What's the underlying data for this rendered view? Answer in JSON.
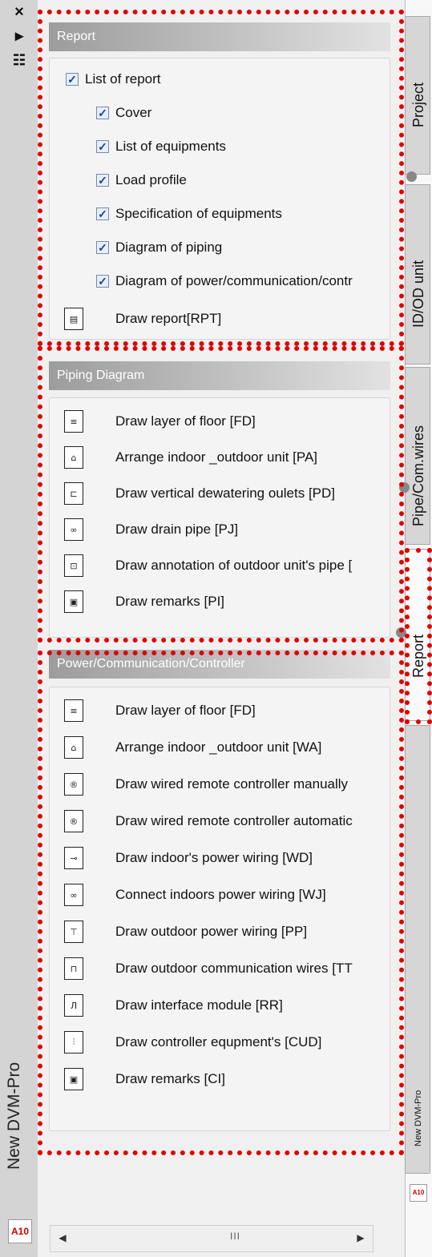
{
  "palette": {
    "title": "New DVM-Pro",
    "logo_text": "A10",
    "close_icon": "×",
    "pin_icon": "▸",
    "props_icon": "☷"
  },
  "groups": {
    "report": {
      "header": "Report",
      "list_of_report": "List of report",
      "checkbox_items": [
        "Cover",
        "List of equipments",
        "Load profile",
        "Specification of equipments",
        "Diagram of piping",
        "Diagram of power/communication/contr"
      ],
      "draw_report": "Draw report[RPT]"
    },
    "piping": {
      "header": "Piping Diagram",
      "commands": [
        "Draw layer of floor [FD]",
        "Arrange indoor _outdoor unit [PA]",
        "Draw vertical dewatering oulets [PD]",
        "Draw drain pipe [PJ]",
        "Draw annotation of outdoor unit's pipe [",
        "Draw remarks [PI]"
      ]
    },
    "power": {
      "header": "Power/Communication/Controller",
      "commands": [
        "Draw layer of floor [FD]",
        "Arrange indoor _outdoor unit [WA]",
        "Draw wired remote controller manually",
        "Draw wired remote controller automatic",
        "Draw indoor's power wiring [WD]",
        "Connect indoors power wiring [WJ]",
        "Draw outdoor power wiring [PP]",
        "Draw outdoor communication wires [TT",
        "Draw interface module [RR]",
        "Draw controller equpment's [CUD]",
        "Draw remarks [CI]"
      ]
    }
  },
  "tabs": [
    "Project",
    "ID/OD unit",
    "Pipe/Com.wires",
    "Report"
  ],
  "secondary_palette": {
    "title": "New DVM-Pro",
    "logo_text": "A10"
  },
  "scrollbar": {
    "thumb": "III"
  },
  "icons": {
    "report": "▤",
    "piping": [
      "≡",
      "⌂",
      "⊏",
      "∞",
      "⊡",
      "▣"
    ],
    "power": [
      "≡",
      "⌂",
      "®",
      "®",
      "⊸",
      "∞",
      "⊤",
      "⊓",
      "Л",
      "⫶",
      "▣"
    ]
  }
}
